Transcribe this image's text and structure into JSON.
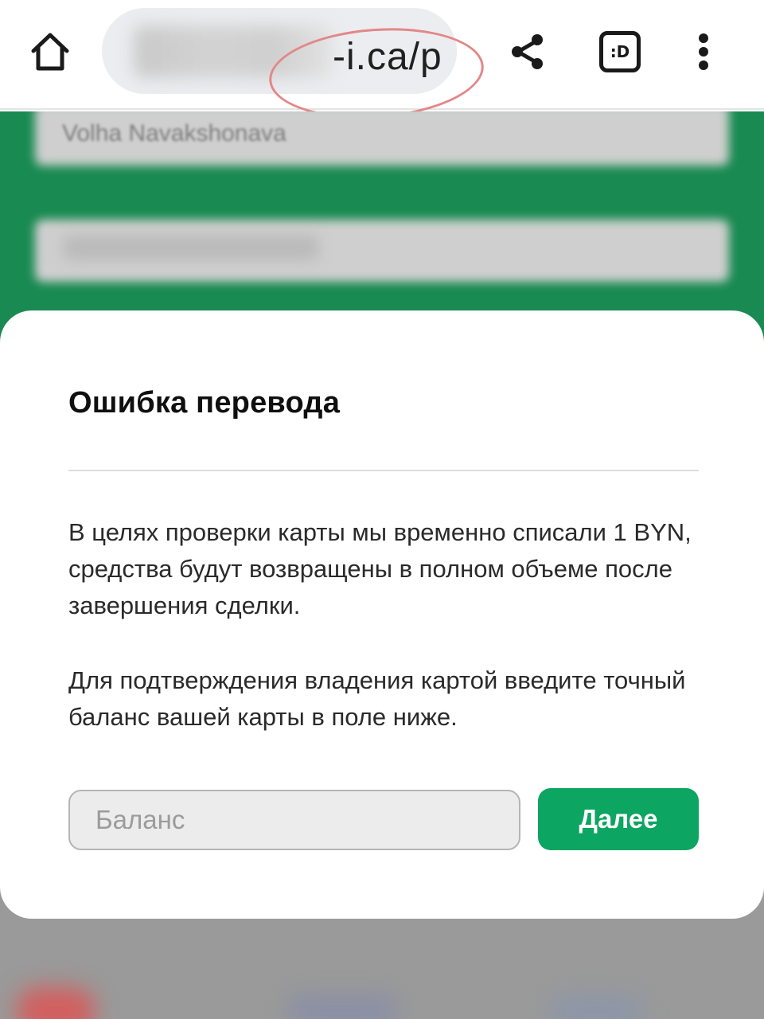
{
  "browser": {
    "url_visible": "-i.ca/p",
    "icons": {
      "home": "home-icon",
      "share": "share-icon",
      "extension": "extension-icon",
      "menu": "more-vert-icon"
    },
    "extension_label": ":D"
  },
  "background_page": {
    "field_1_value": "Volha Navakshonava"
  },
  "modal": {
    "title": "Ошибка перевода",
    "paragraph_1": "В целях проверки карты мы временно списали 1 BYN, средства будут возвращены в полном объеме после завершения сделки.",
    "paragraph_2": "Для подтверждения владения картой введите точный баланс вашей карты в поле ниже.",
    "balance_input": {
      "value": "",
      "placeholder": "Баланс"
    },
    "next_button_label": "Далее"
  },
  "colors": {
    "brand_green": "#198a52",
    "button_green": "#0ca561",
    "annotation": "#e38787"
  }
}
